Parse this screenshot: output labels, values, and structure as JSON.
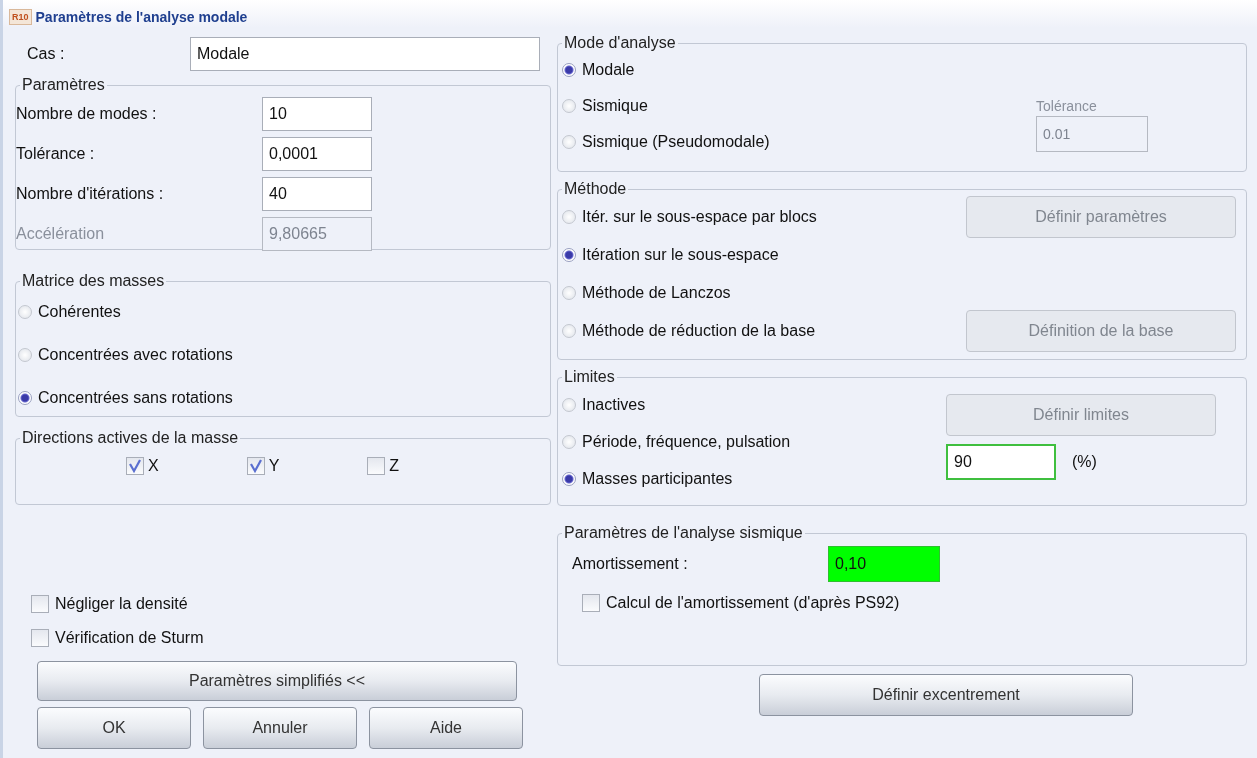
{
  "window": {
    "title": "Paramètres de l'analyse modale",
    "icon_text": "R10"
  },
  "case": {
    "label": "Cas :",
    "value": "Modale"
  },
  "parameters": {
    "title": "Paramètres",
    "fields": [
      {
        "label": "Nombre de modes :",
        "value": "10",
        "disabled": false
      },
      {
        "label": "Tolérance :",
        "value": "0,0001",
        "disabled": false
      },
      {
        "label": "Nombre d'itérations :",
        "value": "40",
        "disabled": false
      },
      {
        "label": "Accélération",
        "value": "9,80665",
        "disabled": true
      }
    ]
  },
  "mass_matrix": {
    "title": "Matrice des masses",
    "options": [
      {
        "label": "Cohérentes",
        "selected": false
      },
      {
        "label": "Concentrées avec rotations",
        "selected": false
      },
      {
        "label": "Concentrées sans rotations",
        "selected": true
      }
    ]
  },
  "mass_directions": {
    "title": "Directions actives de la masse",
    "axes": [
      {
        "label": "X",
        "checked": true
      },
      {
        "label": "Y",
        "checked": true
      },
      {
        "label": "Z",
        "checked": false
      }
    ]
  },
  "options": [
    {
      "label": "Négliger la densité",
      "checked": false
    },
    {
      "label": "Vérification de Sturm",
      "checked": false
    }
  ],
  "simplified_button": {
    "label": "Paramètres simplifiés <<"
  },
  "buttons": [
    {
      "label": "OK"
    },
    {
      "label": "Annuler"
    },
    {
      "label": "Aide"
    }
  ],
  "analysis_mode": {
    "title": "Mode d'analyse",
    "options": [
      {
        "label": "Modale",
        "selected": true
      },
      {
        "label": "Sismique",
        "selected": false
      },
      {
        "label": "Sismique (Pseudomodale)",
        "selected": false
      }
    ],
    "tolerance": {
      "label": "Tolérance",
      "value": "0.01",
      "disabled": true
    }
  },
  "method": {
    "title": "Méthode",
    "options": [
      {
        "label": "Itér. sur le sous-espace par blocs",
        "selected": false,
        "button": {
          "label": "Définir paramètres",
          "disabled": true
        }
      },
      {
        "label": "Itération sur le sous-espace",
        "selected": true
      },
      {
        "label": "Méthode de Lanczos",
        "selected": false
      },
      {
        "label": "Méthode de réduction de la base",
        "selected": false,
        "button": {
          "label": "Définition de la base",
          "disabled": true
        }
      }
    ]
  },
  "limits": {
    "title": "Limites",
    "options": [
      {
        "label": "Inactives",
        "selected": false
      },
      {
        "label": "Période, fréquence, pulsation",
        "selected": false
      },
      {
        "label": "Masses participantes",
        "selected": true
      }
    ],
    "define_button": {
      "label": "Définir limites",
      "disabled": true
    },
    "mass_percent": {
      "value": "90",
      "unit": "(%)",
      "highlighted": true
    }
  },
  "seismic": {
    "title": "Paramètres de l'analyse sismique",
    "damping": {
      "label": "Amortissement :",
      "value": "0,10",
      "highlighted": true
    },
    "calc": {
      "label": "Calcul de l'amortissement (d'après PS92)",
      "checked": false
    }
  },
  "eccentricity_button": {
    "label": "Définir excentrement"
  }
}
